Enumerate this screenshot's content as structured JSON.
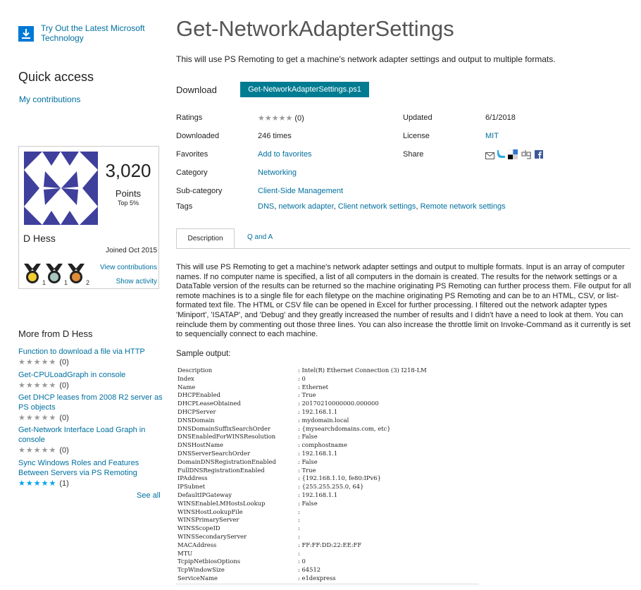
{
  "sidebar": {
    "promo": {
      "icon": "download-icon",
      "text": "Try Out the Latest Microsoft Technology"
    },
    "quick_access": {
      "title": "Quick access",
      "my_contributions": "My contributions"
    },
    "profile": {
      "points": "3,020",
      "points_label": "Points",
      "top": "Top 5%",
      "name": "D Hess",
      "joined": "Joined Oct 2015",
      "medals": [
        {
          "color": "#f2cc30",
          "count": "1"
        },
        {
          "color": "#a9c6c0",
          "count": "1"
        },
        {
          "color": "#e08a3a",
          "count": "2"
        }
      ],
      "view_contributions": "View contributions",
      "show_activity": "Show activity"
    },
    "more": {
      "title": "More from D Hess",
      "items": [
        {
          "title": "Function to download a file via HTTP",
          "stars": "★★★★★",
          "count": "(0)"
        },
        {
          "title": "Get-CPULoadGraph in console",
          "stars": "★★★★★",
          "count": "(0)"
        },
        {
          "title": "Get DHCP leases from 2008 R2 server as PS objects",
          "stars": "★★★★★",
          "count": "(0)"
        },
        {
          "title": "Get-Network Interface Load Graph in console",
          "stars": "★★★★★",
          "count": "(0)"
        },
        {
          "title": "Sync Windows Roles and Features Between Servers via PS Remoting",
          "stars": "★★★★★",
          "count": "(1)"
        }
      ],
      "see_all": "See all"
    }
  },
  "main": {
    "title": "Get-NetworkAdapterSettings",
    "subtitle": "This will use PS Remoting to get a machine's network adapter settings and output to multiple formats.",
    "download_label": "Download",
    "download_button": "Get-NetworkAdapterSettings.ps1",
    "meta": {
      "ratings_label": "Ratings",
      "ratings_stars": "★★★★★",
      "ratings_count": "(0)",
      "updated_label": "Updated",
      "updated_value": "6/1/2018",
      "downloaded_label": "Downloaded",
      "downloaded_value": "246 times",
      "license_label": "License",
      "license_value": "MIT",
      "favorites_label": "Favorites",
      "favorites_value": "Add to favorites",
      "share_label": "Share",
      "category_label": "Category",
      "category_value": "Networking",
      "subcategory_label": "Sub-category",
      "subcategory_value": "Client-Side Management",
      "tags_label": "Tags",
      "tags": [
        "DNS",
        "network adapter",
        "Client network settings",
        "Remote network settings"
      ]
    },
    "tabs": {
      "description": "Description",
      "qa": "Q and A"
    },
    "description": "This will use PS Remoting to get a machine's network adapter settings and output to multiple formats.  Input is an array of computer names.  If no computer name is specified, a list of all computers in the domain is created.  The results for the network settings or a DataTable version of the results can be returned so the machine originating PS Remoting can further process them.  File output for all remote machines is to a single file for each filetype on the machine originating PS Remoting and can be to an HTML, CSV, or list-formated text file.  The HTML or CSV file can be opened in Excel for further processing.  I filtered out the network adapter types 'Miniport', 'ISATAP', and 'Debug' and they greatly increased the number of results and I didn't have a need to look at them.  You can reinclude them by commenting out those three lines.  You can also increase the throttle limit on Invoke-Command as it currently is set to sequencially connect to each machine.",
    "sample_label": "Sample output:",
    "sample_output": [
      [
        "Description",
        ": Intel(R) Ethernet Connection (3) I218-LM"
      ],
      [
        "Index",
        ": 0"
      ],
      [
        "Name",
        ": Ethernet"
      ],
      [
        "DHCPEnabled",
        ": True"
      ],
      [
        "DHCPLeaseObtained",
        ": 20170210000000.000000"
      ],
      [
        "DHCPServer",
        ": 192.168.1.1"
      ],
      [
        "DNSDomain",
        ": mydomain.local"
      ],
      [
        "DNSDomainSuffixSearchOrder",
        ": {mysearchdomains.com, etc}"
      ],
      [
        "DNSEnabledForWINSResolution",
        ": False"
      ],
      [
        "DNSHostName",
        ": comphostname"
      ],
      [
        "DNSServerSearchOrder",
        ": 192.168.1.1"
      ],
      [
        "DomainDNSRegistrationEnabled",
        ": False"
      ],
      [
        "FullDNSRegistrationEnabled",
        ": True"
      ],
      [
        "IPAddress",
        ": {192.168.1.10, fe80:IPv6}"
      ],
      [
        "IPSubnet",
        ": {255.255.255.0, 64}"
      ],
      [
        "DefaultIPGateway",
        ": 192.168.1.1"
      ],
      [
        "WINSEnableLMHostsLookup",
        ": False"
      ],
      [
        "WINSHostLookupFile",
        ":"
      ],
      [
        "WINSPrimaryServer",
        ":"
      ],
      [
        "WINSScopeID",
        ":"
      ],
      [
        "WINSSecondaryServer",
        ":"
      ],
      [
        "MACAddress",
        ": FF:FF:DD:22:EE:FF"
      ],
      [
        "MTU",
        ":"
      ],
      [
        "TcpipNetbiosOptions",
        ": 0"
      ],
      [
        "TcpWindowSize",
        ": 64512"
      ],
      [
        "ServiceName",
        ": e1dexpress"
      ]
    ]
  },
  "colors": {
    "link": "#00709f",
    "button": "#007c92",
    "avatar": "#3f3f9c"
  }
}
